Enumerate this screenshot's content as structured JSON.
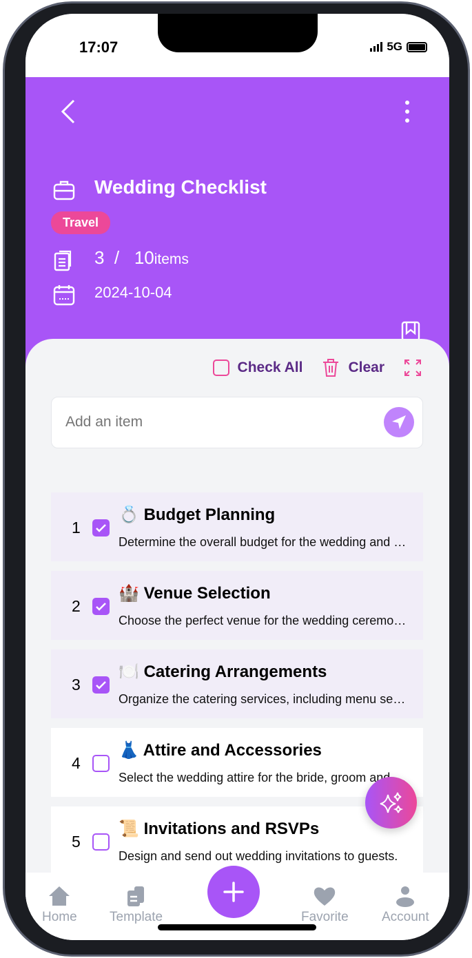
{
  "status": {
    "time": "17:07",
    "network": "5G"
  },
  "header": {
    "title": "Wedding Checklist",
    "tag": "Travel",
    "checked": "3",
    "separator": "/",
    "total": "10",
    "items_label": "items",
    "date": "2024-10-04"
  },
  "actions": {
    "check_all": "Check All",
    "clear": "Clear"
  },
  "add_item": {
    "placeholder": "Add an item"
  },
  "items": [
    {
      "num": "1",
      "emoji": "💍",
      "title": "Budget Planning",
      "desc": "Determine the overall budget for the wedding and allocate funds.",
      "checked": true
    },
    {
      "num": "2",
      "emoji": "🏰",
      "title": "Venue Selection",
      "desc": "Choose the perfect venue for the wedding ceremony and reception.",
      "checked": true
    },
    {
      "num": "3",
      "emoji": "🍽️",
      "title": "Catering Arrangements",
      "desc": "Organize the catering services, including menu selection.",
      "checked": true
    },
    {
      "num": "4",
      "emoji": "👗",
      "title": "Attire and Accessories",
      "desc": "Select the wedding attire for the bride, groom and party.",
      "checked": false
    },
    {
      "num": "5",
      "emoji": "📜",
      "title": "Invitations and RSVPs",
      "desc": "Design and send out wedding invitations to guests.",
      "checked": false
    }
  ],
  "nav": {
    "home": "Home",
    "template": "Template",
    "favorite": "Favorite",
    "account": "Account"
  },
  "colors": {
    "primary": "#a855f7",
    "accent": "#ec4899"
  }
}
